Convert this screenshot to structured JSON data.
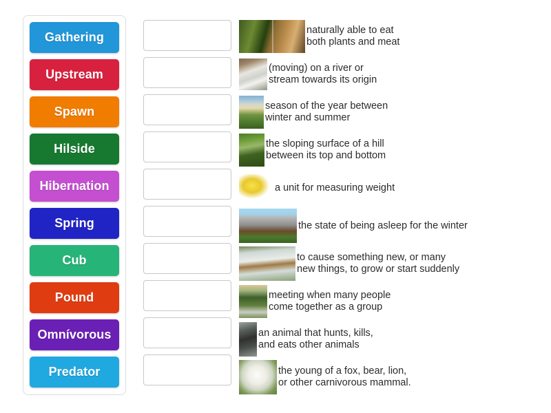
{
  "word_bank": {
    "cards": [
      {
        "label": "Gathering",
        "color": "#2196d9"
      },
      {
        "label": "Upstream",
        "color": "#d8213e"
      },
      {
        "label": "Spawn",
        "color": "#f07c00"
      },
      {
        "label": "Hilside",
        "color": "#16792f"
      },
      {
        "label": "Hibernation",
        "color": "#c44fd0"
      },
      {
        "label": "Spring",
        "color": "#2124c4"
      },
      {
        "label": "Cub",
        "color": "#27b478"
      },
      {
        "label": "Pound",
        "color": "#e03c12"
      },
      {
        "label": "Omnívorous",
        "color": "#6b20b5"
      },
      {
        "label": "Predator",
        "color": "#20a8e0"
      }
    ]
  },
  "drop_zones": {
    "count": 10,
    "values": [
      "",
      "",
      "",
      "",
      "",
      "",
      "",
      "",
      "",
      ""
    ]
  },
  "definitions": {
    "items": [
      {
        "text": "naturally able to eat\nboth plants and meat",
        "thumb": "bear-pair-image",
        "thumb_class": "thumb-bear-pair",
        "thumb_w": 96,
        "thumb_h": 48
      },
      {
        "text": "(moving) on a river or\nstream towards its origin",
        "thumb": "river-rapids-image",
        "thumb_class": "thumb-rapids",
        "thumb_w": 41,
        "thumb_h": 46
      },
      {
        "text": "season of the year between\nwinter and summer",
        "thumb": "flower-meadow-image",
        "thumb_class": "thumb-meadow",
        "thumb_w": 36,
        "thumb_h": 48
      },
      {
        "text": "the sloping surface of a hill\nbetween its top and bottom",
        "thumb": "green-hill-path-image",
        "thumb_class": "thumb-hillpath",
        "thumb_w": 37,
        "thumb_h": 48
      },
      {
        "text": "a unit for measuring weight",
        "thumb": "yellow-squash-image",
        "thumb_class": "thumb-squash",
        "thumb_w": 50,
        "thumb_h": 40
      },
      {
        "text": "the state of being asleep for the winter",
        "thumb": "bear-cave-image",
        "thumb_class": "thumb-cave",
        "thumb_w": 84,
        "thumb_h": 50
      },
      {
        "text": "to cause something new, or many\nnew things, to grow or start suddenly",
        "thumb": "bears-waterfall-image",
        "thumb_class": "thumb-waterfall",
        "thumb_w": 82,
        "thumb_h": 50
      },
      {
        "text": "meeting when many people\ncome together as a group",
        "thumb": "outdoor-gathering-image",
        "thumb_class": "thumb-gathering",
        "thumb_w": 41,
        "thumb_h": 48
      },
      {
        "text": "an animal that hunts, kills,\nand eats other animals",
        "thumb": "wolf-predator-image",
        "thumb_class": "thumb-wolf",
        "thumb_w": 26,
        "thumb_h": 50
      },
      {
        "text": "the young of a fox, bear, lion,\nor other carnivorous mammal.",
        "thumb": "white-bear-cub-image",
        "thumb_class": "thumb-cubwhite",
        "thumb_w": 55,
        "thumb_h": 50
      }
    ]
  }
}
